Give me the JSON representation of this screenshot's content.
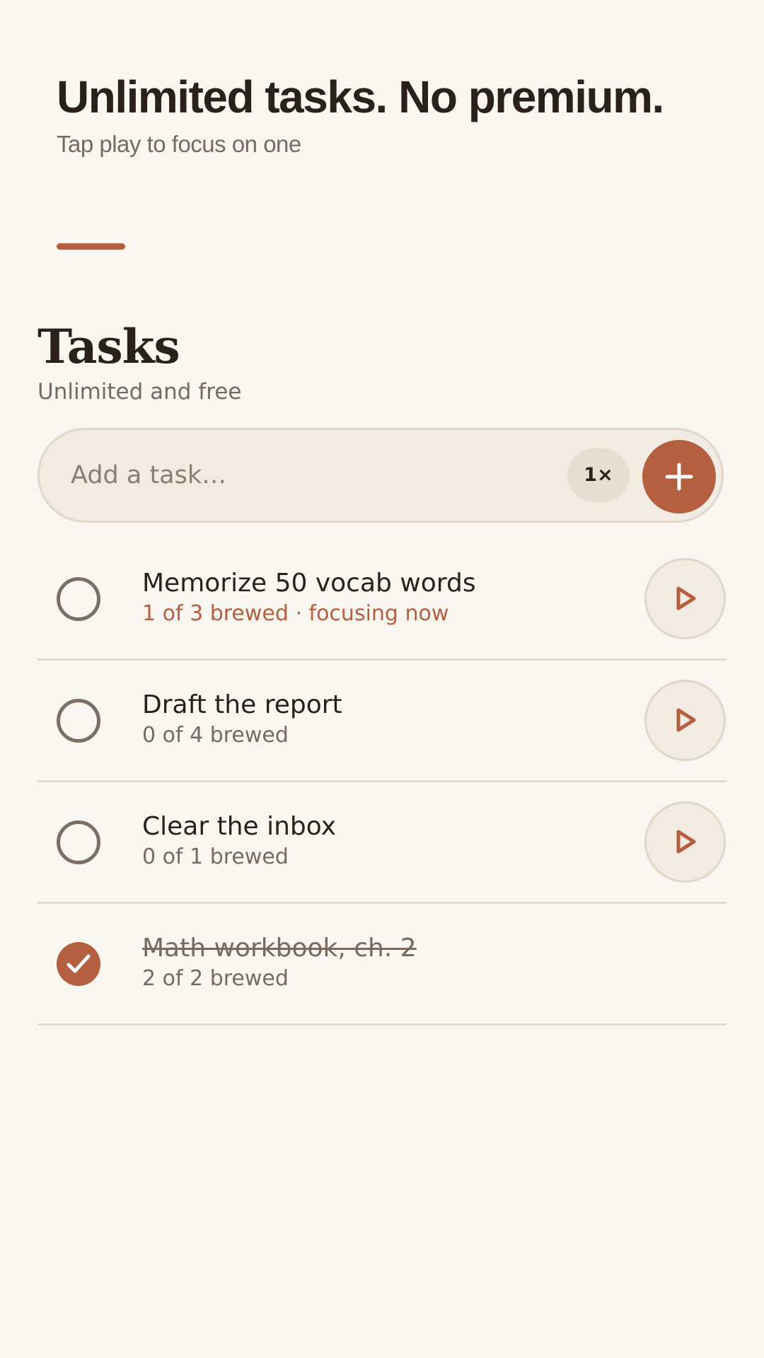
{
  "promo": {
    "headline": "Unlimited tasks. No premium.",
    "subtitle": "Tap play to focus on one"
  },
  "tasks_section": {
    "title": "Tasks",
    "subtitle": "Unlimited and free"
  },
  "add_task": {
    "placeholder": "Add a task…",
    "value": "",
    "speed_label": "1×",
    "add_icon": "plus-icon"
  },
  "tasks": [
    {
      "name": "Memorize 50 vocab words",
      "status": "1 of 3 brewed · focusing now",
      "done": false,
      "active": true,
      "brewed": 1,
      "total": 3
    },
    {
      "name": "Draft the report",
      "status": "0 of 4 brewed",
      "done": false,
      "active": false,
      "brewed": 0,
      "total": 4
    },
    {
      "name": "Clear the inbox",
      "status": "0 of 1 brewed",
      "done": false,
      "active": false,
      "brewed": 0,
      "total": 1
    },
    {
      "name": "Math workbook, ch. 2",
      "status": "2 of 2 brewed",
      "done": true,
      "active": false,
      "brewed": 2,
      "total": 2
    }
  ],
  "icons": {
    "play": "play-icon",
    "check": "check-icon",
    "plus": "plus-icon"
  },
  "colors": {
    "accent": "#b35f40",
    "background": "#f9f5f0",
    "text": "#2a211c",
    "muted": "#776a5f"
  }
}
